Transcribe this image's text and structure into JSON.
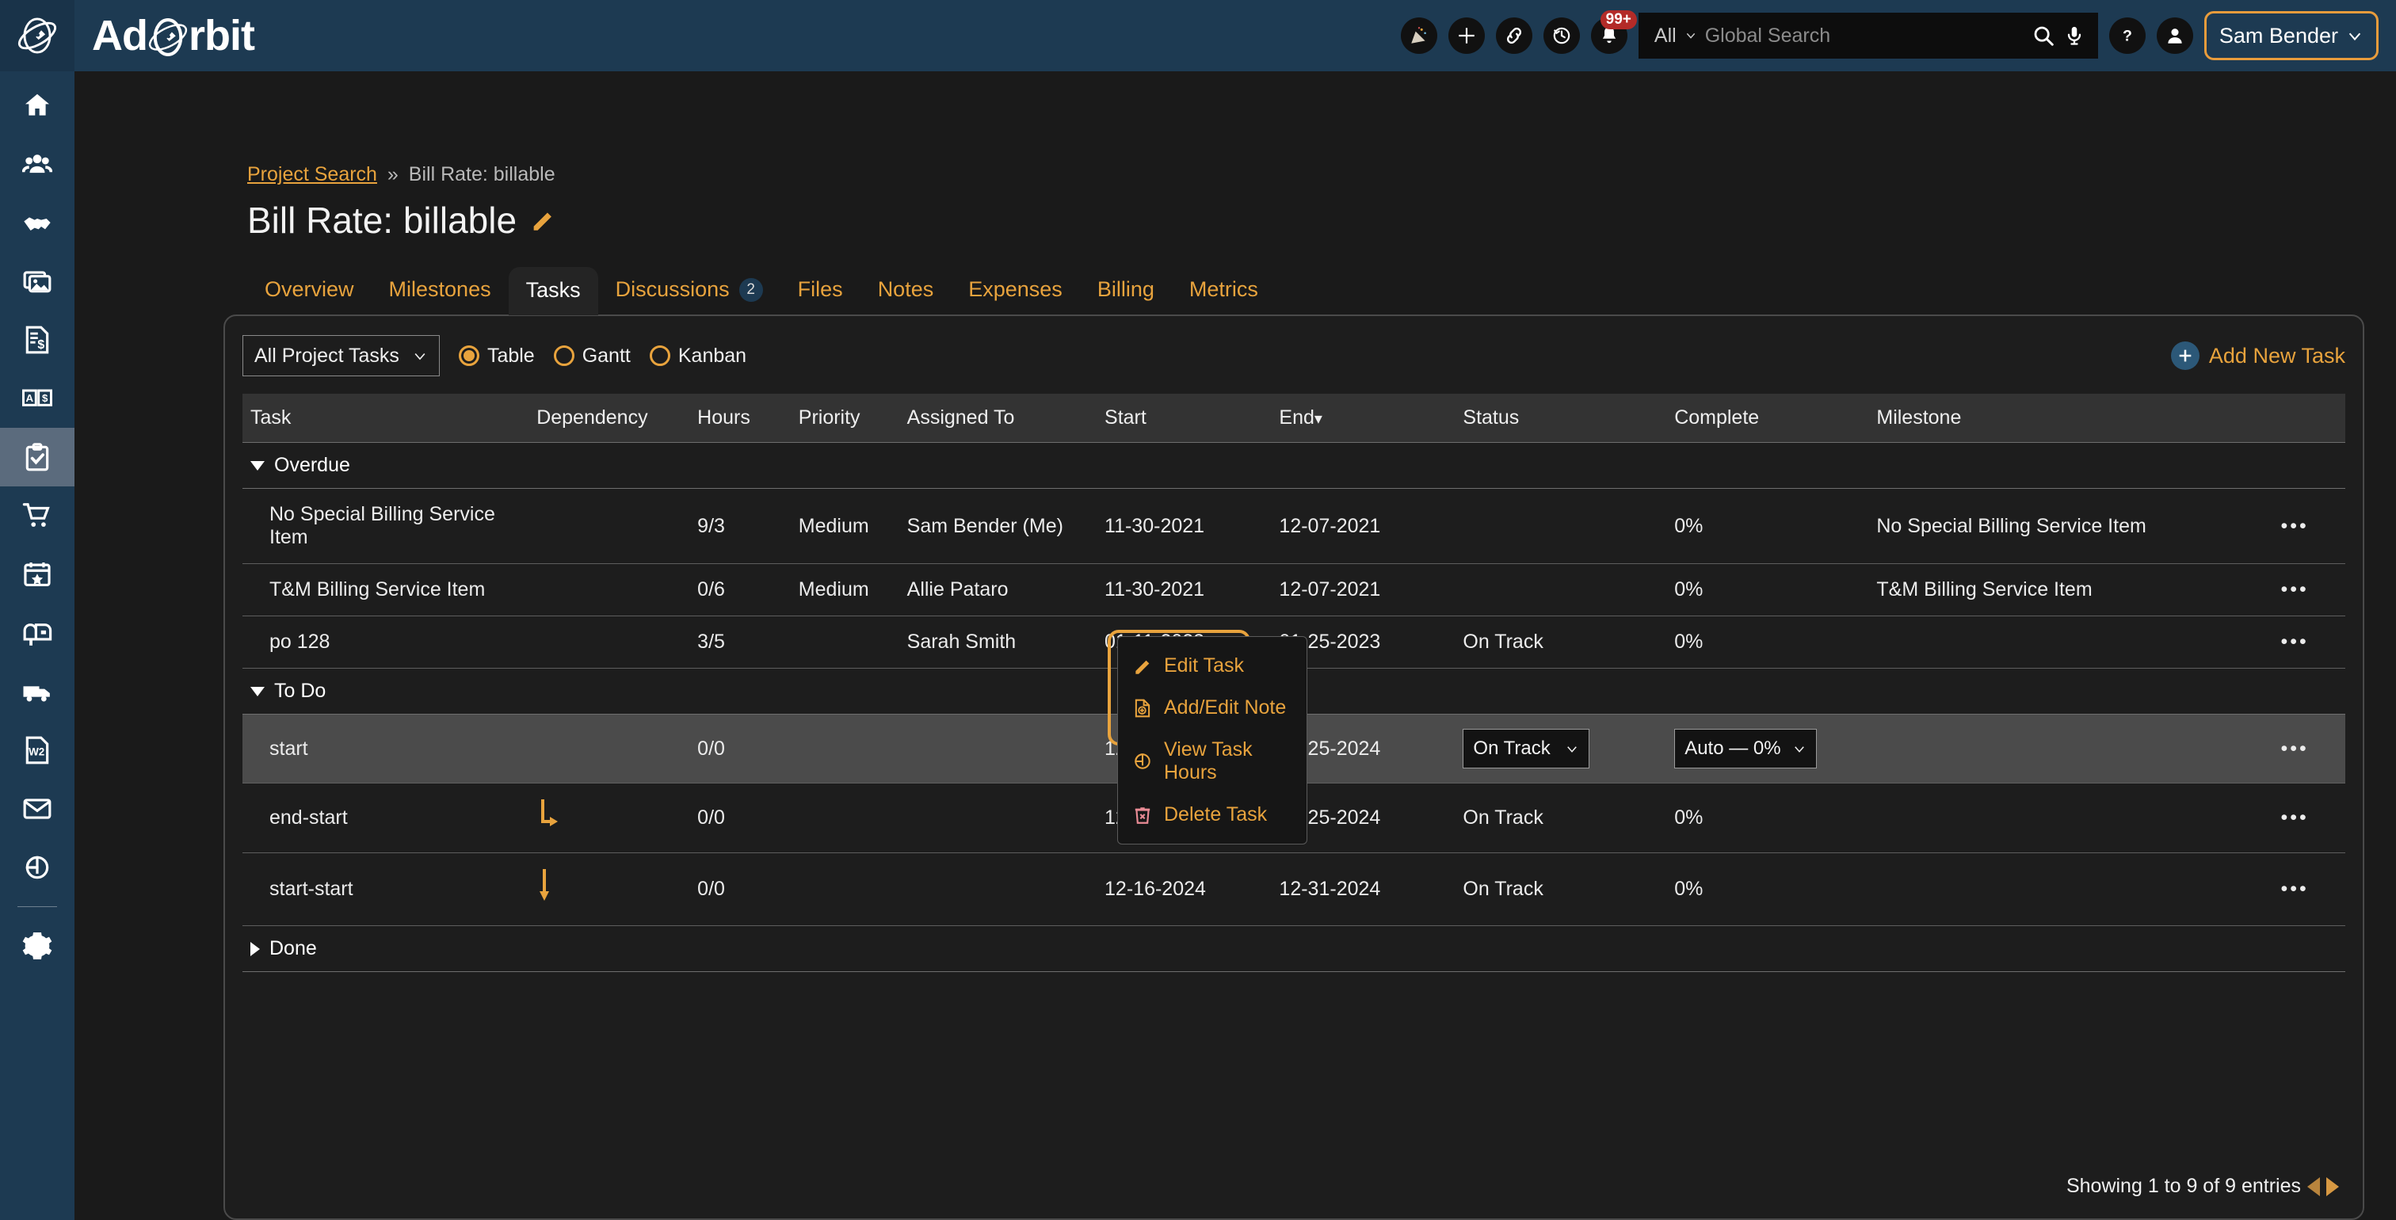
{
  "brand": {
    "name_part1": "Ad",
    "name_part2": "rbit"
  },
  "header": {
    "search_scope": "All",
    "search_placeholder": "Global Search",
    "notification_badge": "99+",
    "user_name": "Sam Bender",
    "icons": [
      "celebration-icon",
      "add-icon",
      "link-icon",
      "history-icon",
      "bell-icon",
      "search-icon",
      "microphone-icon",
      "help-icon",
      "avatar-icon"
    ]
  },
  "sidebar": {
    "items": [
      {
        "name": "home",
        "active": false
      },
      {
        "name": "contacts",
        "active": false
      },
      {
        "name": "handshake",
        "active": false
      },
      {
        "name": "media",
        "active": false
      },
      {
        "name": "invoice",
        "active": false
      },
      {
        "name": "ratecard",
        "active": false
      },
      {
        "name": "tasks",
        "active": true
      },
      {
        "name": "cart",
        "active": false
      },
      {
        "name": "calendar-star",
        "active": false
      },
      {
        "name": "mailbox",
        "active": false
      },
      {
        "name": "truck",
        "active": false
      },
      {
        "name": "w2",
        "active": false
      },
      {
        "name": "email",
        "active": false
      },
      {
        "name": "reports",
        "active": false
      },
      {
        "name": "settings",
        "active": false
      }
    ]
  },
  "breadcrumb": {
    "link": "Project Search",
    "separator": "»",
    "current": "Bill Rate: billable"
  },
  "page": {
    "title": "Bill Rate: billable"
  },
  "tabs": [
    {
      "label": "Overview",
      "active": false,
      "badge": null
    },
    {
      "label": "Milestones",
      "active": false,
      "badge": null
    },
    {
      "label": "Tasks",
      "active": true,
      "badge": null
    },
    {
      "label": "Discussions",
      "active": false,
      "badge": "2"
    },
    {
      "label": "Files",
      "active": false,
      "badge": null
    },
    {
      "label": "Notes",
      "active": false,
      "badge": null
    },
    {
      "label": "Expenses",
      "active": false,
      "badge": null
    },
    {
      "label": "Billing",
      "active": false,
      "badge": null
    },
    {
      "label": "Metrics",
      "active": false,
      "badge": null
    }
  ],
  "toolbar": {
    "filter_value": "All Project Tasks",
    "views": [
      {
        "label": "Table",
        "selected": true
      },
      {
        "label": "Gantt",
        "selected": false
      },
      {
        "label": "Kanban",
        "selected": false
      }
    ],
    "add_task_label": "Add New Task"
  },
  "table": {
    "columns": [
      "Task",
      "Dependency",
      "Hours",
      "Priority",
      "Assigned To",
      "Start",
      "End",
      "Status",
      "Complete",
      "Milestone",
      ""
    ],
    "sorted_column": "End",
    "sort_direction": "desc",
    "groups": [
      {
        "name": "Overdue",
        "expanded": true,
        "rows": [
          {
            "task": "No Special Billing Service Item",
            "dependency": "",
            "hours": "9/3",
            "priority": "Medium",
            "assigned_to": "Sam Bender (Me)",
            "start": "11-30-2021",
            "end": "12-07-2021",
            "status": "",
            "complete": "0%",
            "milestone": "No Special Billing Service Item",
            "highlighted": false
          },
          {
            "task": "T&M Billing Service Item",
            "dependency": "",
            "hours": "0/6",
            "priority": "Medium",
            "assigned_to": "Allie Pataro",
            "start": "11-30-2021",
            "end": "12-07-2021",
            "status": "",
            "complete": "0%",
            "milestone": "T&M Billing Service Item",
            "highlighted": false
          },
          {
            "task": "po 128",
            "dependency": "",
            "hours": "3/5",
            "priority": "",
            "assigned_to": "Sarah Smith",
            "start": "01-11-2023",
            "end": "01-25-2023",
            "status": "On Track",
            "complete": "0%",
            "milestone": "",
            "highlighted": false
          }
        ]
      },
      {
        "name": "To Do",
        "expanded": true,
        "rows": [
          {
            "task": "start",
            "dependency": "",
            "hours": "0/0",
            "priority": "",
            "assigned_to": "",
            "start": "12-18-2024",
            "end": "12-25-2024",
            "status": "On Track",
            "complete": "Auto — 0%",
            "milestone": "",
            "highlighted": true,
            "editing": true
          },
          {
            "task": "end-start",
            "dependency": "end-start-arrow",
            "hours": "0/0",
            "priority": "",
            "assigned_to": "",
            "start": "12-18-2024",
            "end": "12-25-2024",
            "status": "On Track",
            "complete": "0%",
            "milestone": "",
            "highlighted": false
          },
          {
            "task": "start-start",
            "dependency": "start-start-arrow",
            "hours": "0/0",
            "priority": "",
            "assigned_to": "",
            "start": "12-16-2024",
            "end": "12-31-2024",
            "status": "On Track",
            "complete": "0%",
            "milestone": "",
            "highlighted": false
          }
        ]
      },
      {
        "name": "Done",
        "expanded": false,
        "rows": []
      }
    ]
  },
  "context_menu": {
    "items": [
      {
        "label": "Edit Task",
        "icon": "pencil-icon"
      },
      {
        "label": "Add/Edit Note",
        "icon": "note-add-icon"
      },
      {
        "label": "View Task Hours",
        "icon": "pie-chart-icon"
      },
      {
        "label": "Delete Task",
        "icon": "trash-icon"
      }
    ]
  },
  "footer": {
    "entries_text": "Showing 1 to 9 of 9 entries"
  },
  "colors": {
    "accent_orange": "#e8a33d",
    "header_blue": "#1d3a52",
    "status_blue": "#7fc9dd",
    "danger_pink": "#e98b95",
    "badge_red": "#b32b28"
  }
}
